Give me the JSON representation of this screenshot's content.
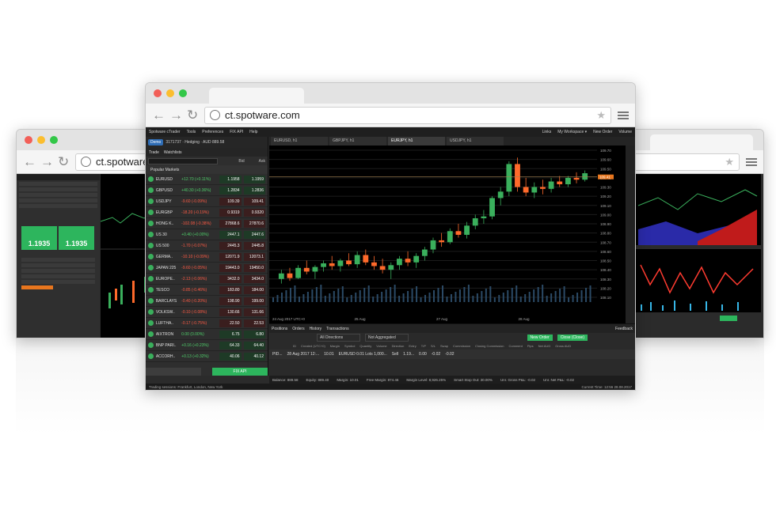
{
  "browsers": {
    "main_url": "ct.spotware.com",
    "left_url": "ct.spotware",
    "star": "★"
  },
  "app": {
    "menu": [
      "Spotware cTrader",
      "Tools",
      "Preferences",
      "FIX API",
      "Help"
    ],
    "menu_right": [
      "Links",
      "My Workspace ▾",
      "New Order",
      "Volume"
    ],
    "account_badge": "Demo",
    "account_text": "3171737 · Hedging · AUD 889.58",
    "left_tabs": [
      "Trade",
      "Watchlists"
    ],
    "search_placeholder": "",
    "bid_header": "Bid",
    "ask_header": "Ask",
    "popular_label": "Popular Markets",
    "symbols": [
      {
        "sym": "EURUSD",
        "chg": "+12.70 (+0.11%)",
        "dir": "up",
        "bid": "1.1958",
        "ask": "1.1959"
      },
      {
        "sym": "GBPUSD",
        "chg": "+40.30 (+0.36%)",
        "dir": "up",
        "bid": "1.2834",
        "ask": "1.2836"
      },
      {
        "sym": "USDJPY",
        "chg": "-9.60 (-0.09%)",
        "dir": "dn",
        "bid": "109.39",
        "ask": "109.41"
      },
      {
        "sym": "EURGBP",
        "chg": "-18.20 (-0.19%)",
        "dir": "dn",
        "bid": "0.9319",
        "ask": "0.9320"
      },
      {
        "sym": "HONG K..",
        "chg": "-102.08 (-0.38%)",
        "dir": "dn",
        "bid": "27868.6",
        "ask": "27870.6"
      },
      {
        "sym": "US 30",
        "chg": "+0.40 (+0.00%)",
        "dir": "up",
        "bid": "2447.1",
        "ask": "2447.6"
      },
      {
        "sym": "US 500",
        "chg": "-1.70 (-0.07%)",
        "dir": "dn",
        "bid": "2445.3",
        "ask": "2445.8"
      },
      {
        "sym": "GERMA..",
        "chg": "-10.10 (-0.09%)",
        "dir": "dn",
        "bid": "12071.9",
        "ask": "12073.1"
      },
      {
        "sym": "JAPAN 225",
        "chg": "-9.60 (-0.05%)",
        "dir": "dn",
        "bid": "19443.0",
        "ask": "19450.0"
      },
      {
        "sym": "EUROPE..",
        "chg": "-2.13 (-0.06%)",
        "dir": "dn",
        "bid": "3432.0",
        "ask": "3434.0"
      },
      {
        "sym": "TESCO",
        "chg": "-0.85 (-0.46%)",
        "dir": "dn",
        "bid": "183.80",
        "ask": "184.00"
      },
      {
        "sym": "BARCLAYS",
        "chg": "-0.40 (-0.20%)",
        "dir": "dn",
        "bid": "198.90",
        "ask": "199.00"
      },
      {
        "sym": "VOLKSW..",
        "chg": "-0.10 (-0.08%)",
        "dir": "dn",
        "bid": "130.66",
        "ask": "131.66"
      },
      {
        "sym": "LUFTHA..",
        "chg": "-0.17 (-0.75%)",
        "dir": "dn",
        "bid": "22.50",
        "ask": "22.53"
      },
      {
        "sym": "AIXTRON",
        "chg": "0.00 (0.00%)",
        "dir": "up",
        "bid": "6.75",
        "ask": "6.80"
      },
      {
        "sym": "BNP PARI..",
        "chg": "+0.16 (+0.23%)",
        "dir": "up",
        "bid": "64.33",
        "ask": "64.40"
      },
      {
        "sym": "ACCORH..",
        "chg": "+0.13 (+0.32%)",
        "dir": "up",
        "bid": "40.06",
        "ask": "40.12"
      }
    ],
    "fix_api_button": "FIX API",
    "chart_tabs": [
      "EURUSD, h1",
      "GBPJPY, h1",
      "EURJPY, h1",
      "USDJPY, h1"
    ],
    "bottom_tabs": [
      "Positions",
      "Orders",
      "History",
      "Transactions"
    ],
    "feedback": "Feedback",
    "filter_direction": "All Directions",
    "filter_aggregation": "Not Aggregated",
    "new_order": "New Order",
    "close_all": "Close (Close)",
    "columns": [
      "ID",
      "Created (UTC+0)",
      "Margin",
      "Symbol",
      "Quantity",
      "Volume",
      "Direction",
      "Entry",
      "T/P",
      "S/L",
      "Swap",
      "Commission",
      "Closing Commission",
      "Comment",
      "Pips",
      "Net AUD",
      "Gross AUD"
    ],
    "position_row": [
      "PID...",
      "28 Aug 2017 12:...",
      "10.01",
      "EURUSD 0.01 Lots 1,000...",
      "Sell",
      "1.19...",
      "0.00",
      "-0.02",
      "-0.02"
    ],
    "status_items": [
      "Balance: 889.58",
      "Equity: 889.40",
      "Margin: 10.01",
      "Free Margin: 874.46",
      "Margin Level: 8,926.25%",
      "Smart Stop Out: 30.00%",
      "Unr. Gross P&L: -0.02",
      "Unr. Net P&L: -0.02"
    ],
    "status_time": "Current Time: 12:56 28.08.2017",
    "footer_text": "Trading sessions: Frankfurt, London, New York"
  },
  "left_window": {
    "bid_big": "1.1935",
    "ask_big": "1.1935"
  },
  "chart_data": {
    "type": "candlestick",
    "price_labels": [
      "109.70",
      "109.60",
      "109.50",
      "109.40",
      "109.30",
      "109.20",
      "109.10",
      "109.00",
      "108.90",
      "108.80",
      "108.70",
      "108.60",
      "108.50",
      "108.40",
      "108.30",
      "108.20",
      "108.10"
    ],
    "date_labels": [
      "24 Aug 2017 UTC+0",
      "25 Aug",
      "27 Aug",
      "28 Aug"
    ],
    "current_price": "109.41",
    "ohlc": [
      [
        108.3,
        108.4,
        108.25,
        108.36
      ],
      [
        108.36,
        108.42,
        108.28,
        108.31
      ],
      [
        108.31,
        108.45,
        108.3,
        108.42
      ],
      [
        108.42,
        108.5,
        108.35,
        108.38
      ],
      [
        108.38,
        108.45,
        108.3,
        108.43
      ],
      [
        108.43,
        108.5,
        108.38,
        108.47
      ],
      [
        108.47,
        108.55,
        108.4,
        108.44
      ],
      [
        108.44,
        108.52,
        108.38,
        108.5
      ],
      [
        108.5,
        108.58,
        108.44,
        108.46
      ],
      [
        108.46,
        108.6,
        108.42,
        108.56
      ],
      [
        108.56,
        108.62,
        108.45,
        108.48
      ],
      [
        108.48,
        108.55,
        108.4,
        108.44
      ],
      [
        108.44,
        108.52,
        108.36,
        108.4
      ],
      [
        108.4,
        108.48,
        108.3,
        108.45
      ],
      [
        108.45,
        108.55,
        108.4,
        108.52
      ],
      [
        108.52,
        108.6,
        108.44,
        108.48
      ],
      [
        108.48,
        108.58,
        108.42,
        108.55
      ],
      [
        108.55,
        108.65,
        108.5,
        108.62
      ],
      [
        108.62,
        108.75,
        108.58,
        108.72
      ],
      [
        108.72,
        108.8,
        108.65,
        108.7
      ],
      [
        108.7,
        108.85,
        108.68,
        108.82
      ],
      [
        108.82,
        108.9,
        108.75,
        108.78
      ],
      [
        108.78,
        108.92,
        108.74,
        108.88
      ],
      [
        108.88,
        109.0,
        108.84,
        108.96
      ],
      [
        108.96,
        109.05,
        108.9,
        108.98
      ],
      [
        108.98,
        109.2,
        108.95,
        109.18
      ],
      [
        109.18,
        109.3,
        109.1,
        109.25
      ],
      [
        109.25,
        109.58,
        109.2,
        109.55
      ],
      [
        109.55,
        109.62,
        109.25,
        109.3
      ],
      [
        109.3,
        109.4,
        109.2,
        109.24
      ],
      [
        109.24,
        109.35,
        109.18,
        109.3
      ],
      [
        109.3,
        109.38,
        109.22,
        109.28
      ],
      [
        109.28,
        109.4,
        109.24,
        109.36
      ],
      [
        109.36,
        109.42,
        109.3,
        109.33
      ],
      [
        109.33,
        109.42,
        109.3,
        109.4
      ],
      [
        109.4,
        109.46,
        109.34,
        109.38
      ],
      [
        109.38,
        109.48,
        109.36,
        109.45
      ]
    ]
  },
  "colors": {
    "bull": "#3aaf5c",
    "bear": "#ff6a2b",
    "accent_green": "#2db55d",
    "price_tag": "#e8761e"
  }
}
